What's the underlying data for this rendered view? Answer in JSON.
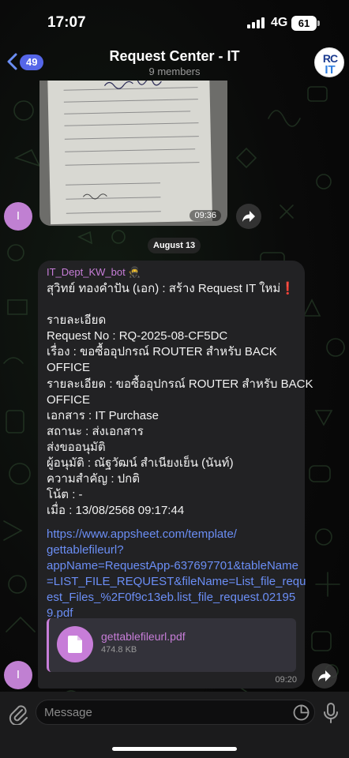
{
  "status": {
    "time": "17:07",
    "network": "4G",
    "battery": "61"
  },
  "header": {
    "back_count": "49",
    "title": "Request Center - IT",
    "members": "9 members",
    "avatar_line1": "RC",
    "avatar_line2": "IT"
  },
  "image_message": {
    "time": "09:36",
    "avatar_letter": "I"
  },
  "date_divider": "August 13",
  "bot_message": {
    "sender": "IT_Dept_KW_bot",
    "lines": [
      "สุวิทย์ ทองคำปัน (เอก) : สร้าง Request IT ใหม่❗",
      "",
      "รายละเอียด",
      "Request No : RQ-2025-08-CF5DC",
      "เรื่อง : ขอซื้ออุปกรณ์ ROUTER สำหรับ BACK",
      "OFFICE",
      "รายละเอียด : ขอซื้ออุปกรณ์ ROUTER สำหรับ BACK",
      "OFFICE",
      "เอกสาร : IT Purchase",
      "สถานะ : ส่งเอกสาร",
      "ส่งขออนุมัติ",
      "ผู้อนุมัติ : ณัฐวัฒน์  สำเนียงเย็น (นันท์)",
      "ความสำคัญ : ปกติ",
      "โน้ต : -",
      "เมื่อ : 13/08/2568 09:17:44"
    ],
    "link_lines": [
      "https://www.appsheet.com/template/",
      "gettablefileurl?",
      "appName=RequestApp-637697701&tableName",
      "=LIST_FILE_REQUEST&fileName=List_file_requ",
      "est_Files_%2F0f9c13eb.list_file_request.02195",
      "9.pdf"
    ],
    "file": {
      "name": "gettablefileurl.pdf",
      "size": "474.8 KB"
    },
    "time": "09:20",
    "avatar_letter": "I"
  },
  "input": {
    "placeholder": "Message"
  },
  "colors": {
    "accent": "#c77dd8",
    "link": "#6b8ef5",
    "badge": "#5566e8",
    "bubble": "#222224"
  }
}
